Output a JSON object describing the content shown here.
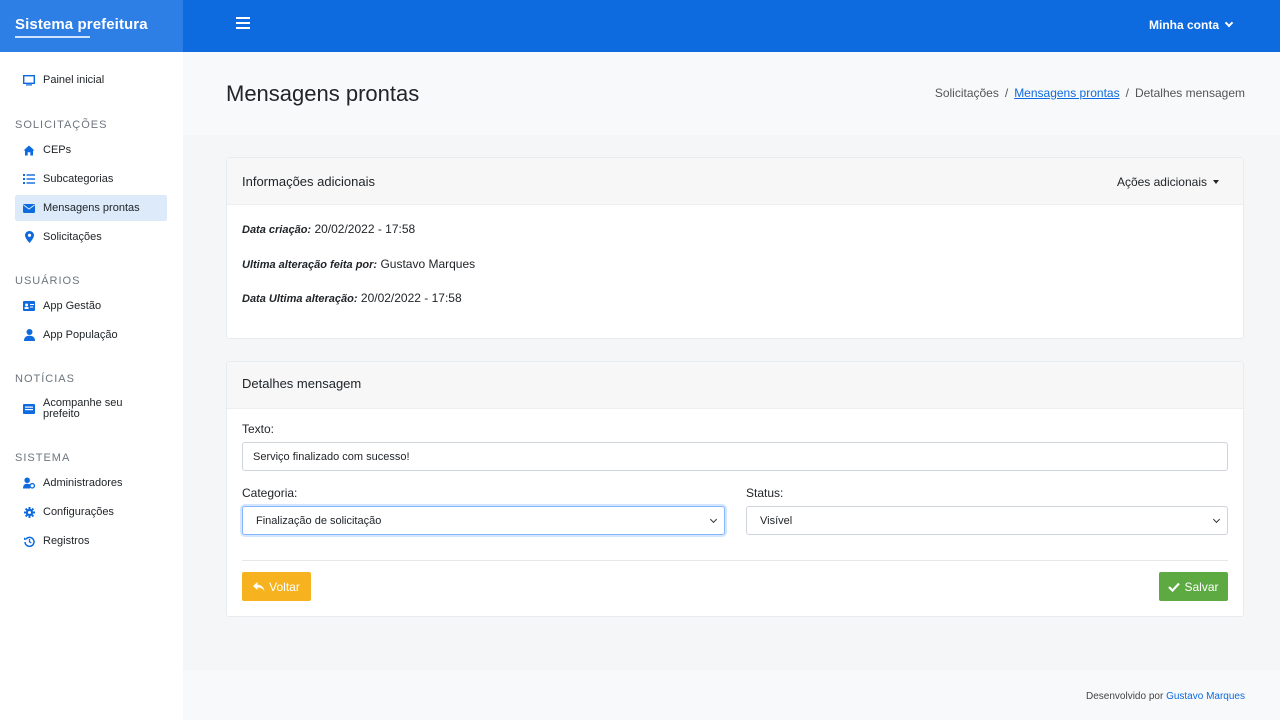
{
  "app": {
    "brand": "Sistema prefeitura",
    "account_label": "Minha conta"
  },
  "sidebar": {
    "home": "Painel inicial",
    "sections": [
      {
        "title": "SOLICITAÇÕES",
        "items": [
          "CEPs",
          "Subcategorias",
          "Mensagens prontas",
          "Solicitações"
        ]
      },
      {
        "title": "USUÁRIOS",
        "items": [
          "App Gestão",
          "App População"
        ]
      },
      {
        "title": "NOTÍCIAS",
        "items": [
          "Acompanhe seu prefeito"
        ]
      },
      {
        "title": "SISTEMA",
        "items": [
          "Administradores",
          "Configurações",
          "Registros"
        ]
      }
    ],
    "active_item": "Mensagens prontas"
  },
  "header": {
    "title": "Mensagens prontas",
    "breadcrumb": [
      "Solicitações",
      "Mensagens prontas",
      "Detalhes mensagem"
    ]
  },
  "info_card": {
    "title": "Informações adicionais",
    "actions_label": "Ações adicionais",
    "created_label": "Data criação:",
    "created_value": "20/02/2022 - 17:58",
    "last_by_label": "Ultima alteração feita por:",
    "last_by_value": "Gustavo Marques",
    "last_date_label": "Data Ultima alteração:",
    "last_date_value": "20/02/2022 - 17:58"
  },
  "details_card": {
    "title": "Detalhes mensagem",
    "text_label": "Texto:",
    "text_value": "Serviço finalizado com sucesso!",
    "category_label": "Categoria:",
    "category_value": "Finalização de solicitação",
    "status_label": "Status:",
    "status_value": "Visível",
    "back_label": "Voltar",
    "save_label": "Salvar"
  },
  "footer": {
    "prefix": "Desenvolvido por",
    "author": "Gustavo Marques"
  },
  "colors": {
    "primary": "#0d6adf",
    "warning": "#f6b21f",
    "success": "#5daa42"
  }
}
